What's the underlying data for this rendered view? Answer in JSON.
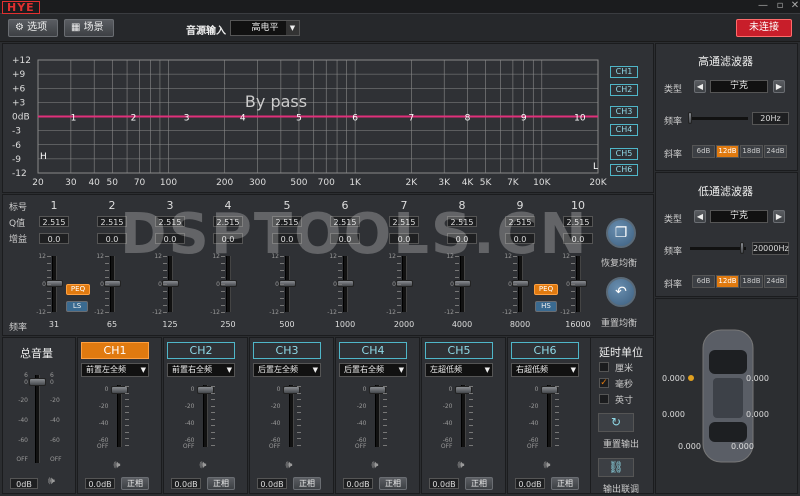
{
  "brand": "HYE",
  "toolbar": {
    "options_label": "选项",
    "scene_label": "场景",
    "source_label": "音源输入",
    "source_value": "高电平",
    "connect_label": "未连接"
  },
  "graph": {
    "title": "By pass",
    "y_labels": [
      "+12",
      "+9",
      "+6",
      "+3",
      "0dB",
      "-3",
      "-6",
      "-9",
      "-12"
    ],
    "x_labels": [
      "20",
      "30",
      "40",
      "50",
      "70",
      "100",
      "200",
      "300",
      "500",
      "700",
      "1K",
      "2K",
      "3K",
      "4K",
      "5K",
      "7K",
      "10K",
      "20K"
    ],
    "band_labels": [
      "1",
      "2",
      "3",
      "4",
      "5",
      "6",
      "7",
      "8",
      "9",
      "10"
    ],
    "h_label": "H",
    "l_label": "L",
    "channels": [
      "CH1",
      "CH2",
      "CH3",
      "CH4",
      "CH5",
      "CH6"
    ],
    "line_color": "#e0307a"
  },
  "eq": {
    "row_labels": {
      "band": "标号",
      "q": "Q值",
      "gain": "增益",
      "freq": "频率"
    },
    "bands": [
      {
        "num": "1",
        "q": "2.515",
        "gain": "0.0",
        "freq": "31"
      },
      {
        "num": "2",
        "q": "2.515",
        "gain": "0.0",
        "freq": "65"
      },
      {
        "num": "3",
        "q": "2.515",
        "gain": "0.0",
        "freq": "125"
      },
      {
        "num": "4",
        "q": "2.515",
        "gain": "0.0",
        "freq": "250"
      },
      {
        "num": "5",
        "q": "2.515",
        "gain": "0.0",
        "freq": "500"
      },
      {
        "num": "6",
        "q": "2.515",
        "gain": "0.0",
        "freq": "1000"
      },
      {
        "num": "7",
        "q": "2.515",
        "gain": "0.0",
        "freq": "2000"
      },
      {
        "num": "8",
        "q": "2.515",
        "gain": "0.0",
        "freq": "4000"
      },
      {
        "num": "9",
        "q": "2.515",
        "gain": "0.0",
        "freq": "8000"
      },
      {
        "num": "10",
        "q": "2.515",
        "gain": "0.0",
        "freq": "16000"
      }
    ],
    "scale": [
      "12",
      "0",
      "-12"
    ],
    "peq_label": "PEQ",
    "ls_label": "LS",
    "hs_label": "HS",
    "restore_label": "恢复均衡",
    "reset_label": "重置均衡"
  },
  "hpf": {
    "title": "高通滤波器",
    "type_label": "类型",
    "type_value": "宁克",
    "freq_label": "频率",
    "freq_value": "20Hz",
    "slope_label": "斜率",
    "slopes": [
      "6dB",
      "12dB",
      "18dB",
      "24dB"
    ],
    "active_slope": "12dB"
  },
  "lpf": {
    "title": "低通滤波器",
    "type_label": "类型",
    "type_value": "宁克",
    "freq_label": "频率",
    "freq_value": "20000Hz",
    "slope_label": "斜率",
    "slopes": [
      "6dB",
      "12dB",
      "18dB",
      "24dB"
    ],
    "active_slope": "12dB"
  },
  "master": {
    "label": "总音量",
    "value": "0dB",
    "scale": [
      "6",
      "0",
      "-20",
      "-40",
      "-60",
      "OFF"
    ]
  },
  "channels": [
    {
      "name": "CH1",
      "assign": "前置左全频",
      "value": "0.0dB",
      "phase": "正相",
      "active": true
    },
    {
      "name": "CH2",
      "assign": "前置右全频",
      "value": "0.0dB",
      "phase": "正相",
      "active": false
    },
    {
      "name": "CH3",
      "assign": "后置左全频",
      "value": "0.0dB",
      "phase": "正相",
      "active": false
    },
    {
      "name": "CH4",
      "assign": "后置右全频",
      "value": "0.0dB",
      "phase": "正相",
      "active": false
    },
    {
      "name": "CH5",
      "assign": "左超低频",
      "value": "0.0dB",
      "phase": "正相",
      "active": false
    },
    {
      "name": "CH6",
      "assign": "右超低频",
      "value": "0.0dB",
      "phase": "正相",
      "active": false
    }
  ],
  "ch_scale": [
    "0",
    "-20",
    "-40",
    "-60",
    "OFF"
  ],
  "delay": {
    "title": "延时单位",
    "units": [
      "厘米",
      "毫秒",
      "英寸"
    ],
    "selected": "毫秒",
    "reset_out_label": "重置输出",
    "link_label": "输出联调"
  },
  "car": {
    "readouts": [
      "0.000",
      "0.000",
      "0.000",
      "0.000",
      "0.000",
      "0.000"
    ]
  },
  "watermark": "DSPTOOLS.CN"
}
